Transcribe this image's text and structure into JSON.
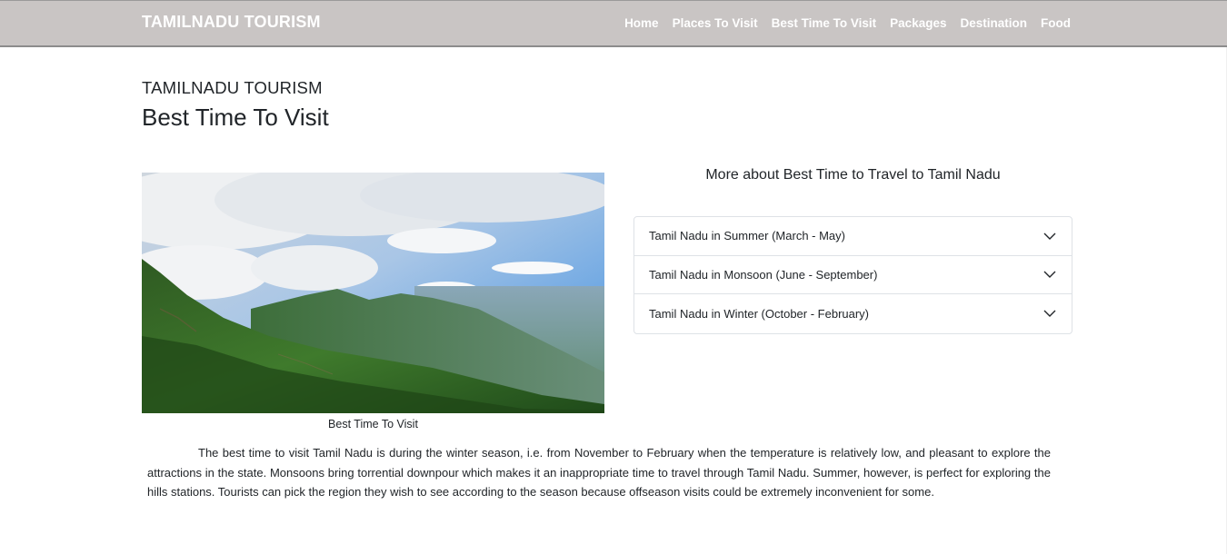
{
  "navbar": {
    "brand": "TAMILNADU TOURISM",
    "links": [
      "Home",
      "Places To Visit",
      "Best Time To Visit",
      "Packages",
      "Destination",
      "Food"
    ]
  },
  "header": {
    "subtitle": "TAMILNADU TOURISM",
    "title": "Best Time To Visit"
  },
  "figure": {
    "caption": "Best Time To Visit"
  },
  "more": {
    "title": "More about Best Time to Travel to Tamil Nadu",
    "items": [
      "Tamil Nadu in Summer (March - May)",
      "Tamil Nadu in Monsoon (June - September)",
      "Tamil Nadu in Winter (October - February)"
    ]
  },
  "description": "The best time to visit Tamil Nadu is during the winter season, i.e. from November to February when the temperature is relatively low, and pleasant to explore the attractions in the state. Monsoons bring torrential downpour which makes it an inappropriate time to travel through Tamil Nadu. Summer, however, is perfect for exploring the hills stations. Tourists can pick the region they wish to see according to the season because offseason visits could be extremely inconvenient for some.",
  "colors": {
    "navbar_bg": "#c9c5c4",
    "nav_text": "#ffffff",
    "text": "#212529",
    "border": "#dee2e6"
  }
}
